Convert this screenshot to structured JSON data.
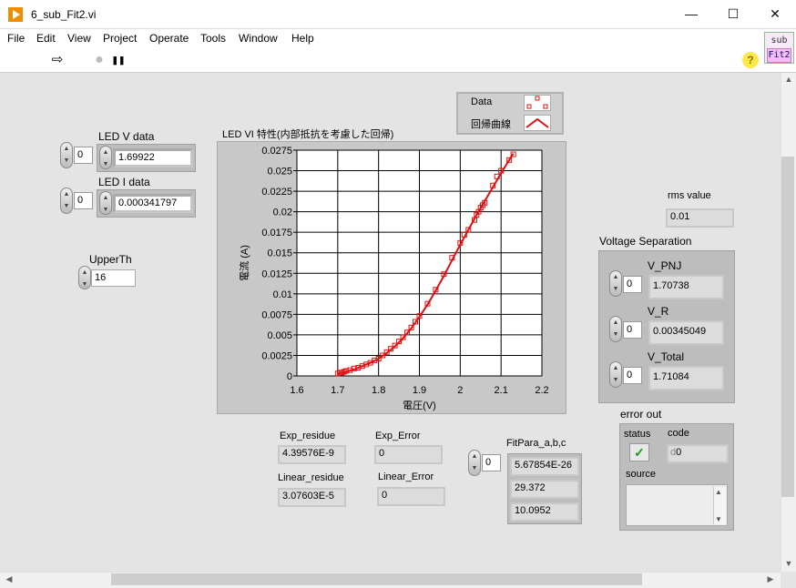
{
  "window": {
    "title": "6_sub_Fit2.vi",
    "min": "—",
    "max": "☐",
    "close": "✕"
  },
  "menu": [
    "File",
    "Edit",
    "View",
    "Project",
    "Operate",
    "Tools",
    "Window",
    "Help"
  ],
  "toolbar": {
    "run": "⇨",
    "abort": "●",
    "pause": "❚❚",
    "help": "?"
  },
  "vi_icon": {
    "line1": "sub",
    "line2": "Fit2"
  },
  "controls": {
    "led_v": {
      "label": "LED V data",
      "index": "0",
      "value": "1.69922"
    },
    "led_i": {
      "label": "LED I data",
      "index": "0",
      "value": "0.000341797"
    },
    "upperth": {
      "label": "UpperTh",
      "value": "16"
    },
    "rms": {
      "label": "rms value",
      "value": "0.01"
    },
    "voltage_separation": {
      "label": "Voltage Separation",
      "v_pnj": {
        "label": "V_PNJ",
        "index": "0",
        "value": "1.70738"
      },
      "v_r": {
        "label": "V_R",
        "index": "0",
        "value": "0.00345049"
      },
      "v_total": {
        "label": "V_Total",
        "index": "0",
        "value": "1.71084"
      }
    },
    "error_out": {
      "label": "error out",
      "status_label": "status",
      "status_mark": "✓",
      "code_label": "code",
      "code_prefix": "d",
      "code_value": "0",
      "source_label": "source"
    },
    "exp_residue": {
      "label": "Exp_residue",
      "value": "4.39576E-9"
    },
    "exp_error": {
      "label": "Exp_Error",
      "value": "0"
    },
    "linear_residue": {
      "label": "Linear_residue",
      "value": "3.07603E-5"
    },
    "linear_error": {
      "label": "Linear_Error",
      "value": "0"
    },
    "fitpara": {
      "label": "FitPara_a,b,c",
      "index": "0",
      "values": [
        "5.67854E-26",
        "29.372",
        "10.0952"
      ]
    }
  },
  "legend": {
    "data": "Data",
    "fit": "回帰曲線"
  },
  "colors": {
    "series": "#e01010",
    "plot_bg": "#ffffff",
    "frame": "#c8c8c8"
  },
  "chart_data": {
    "type": "scatter",
    "title": "LED VI 特性(内部抵抗を考慮した回帰)",
    "xlabel": "電圧(V)",
    "ylabel": "電流 (A)",
    "xlim": [
      1.6,
      2.2
    ],
    "ylim": [
      0,
      0.0275
    ],
    "x_ticks": [
      "1.6",
      "1.7",
      "1.8",
      "1.9",
      "2",
      "2.1",
      "2.2"
    ],
    "y_ticks": [
      "0",
      "0.0025",
      "0.005",
      "0.0075",
      "0.01",
      "0.0125",
      "0.015",
      "0.0175",
      "0.02",
      "0.0225",
      "0.025",
      "0.0275"
    ],
    "grid": true,
    "series": [
      {
        "name": "Data",
        "marker": "square",
        "x": [
          1.7,
          1.705,
          1.71,
          1.715,
          1.72,
          1.73,
          1.74,
          1.75,
          1.76,
          1.77,
          1.78,
          1.79,
          1.8,
          1.81,
          1.82,
          1.83,
          1.84,
          1.85,
          1.86,
          1.87,
          1.88,
          1.89,
          1.9,
          1.92,
          1.94,
          1.96,
          1.98,
          2.0,
          2.01,
          2.02,
          2.035,
          2.04,
          2.045,
          2.05,
          2.055,
          2.06,
          2.08,
          2.09,
          2.1,
          2.12,
          2.13
        ],
        "y": [
          0.0003,
          0.0004,
          0.0004,
          0.0005,
          0.0006,
          0.0007,
          0.0009,
          0.001,
          0.0012,
          0.0014,
          0.0016,
          0.0019,
          0.0021,
          0.0025,
          0.0029,
          0.0033,
          0.0037,
          0.0042,
          0.0047,
          0.0053,
          0.0059,
          0.0066,
          0.0073,
          0.0088,
          0.0105,
          0.0124,
          0.0144,
          0.0162,
          0.0172,
          0.0178,
          0.019,
          0.0196,
          0.02,
          0.0205,
          0.0208,
          0.0211,
          0.0232,
          0.0243,
          0.025,
          0.0263,
          0.027
        ]
      },
      {
        "name": "回帰曲線",
        "x": [
          1.7,
          1.72,
          1.74,
          1.76,
          1.78,
          1.8,
          1.82,
          1.84,
          1.86,
          1.88,
          1.9,
          1.92,
          1.94,
          1.96,
          1.98,
          2.0,
          2.02,
          2.04,
          2.06,
          2.08,
          2.1,
          2.12,
          2.13
        ],
        "y": [
          0.0003,
          0.0005,
          0.0008,
          0.0012,
          0.0016,
          0.0021,
          0.0028,
          0.0036,
          0.0046,
          0.0058,
          0.0072,
          0.0087,
          0.0104,
          0.0122,
          0.0141,
          0.016,
          0.0178,
          0.0196,
          0.0213,
          0.023,
          0.0247,
          0.0263,
          0.0271
        ]
      }
    ]
  }
}
